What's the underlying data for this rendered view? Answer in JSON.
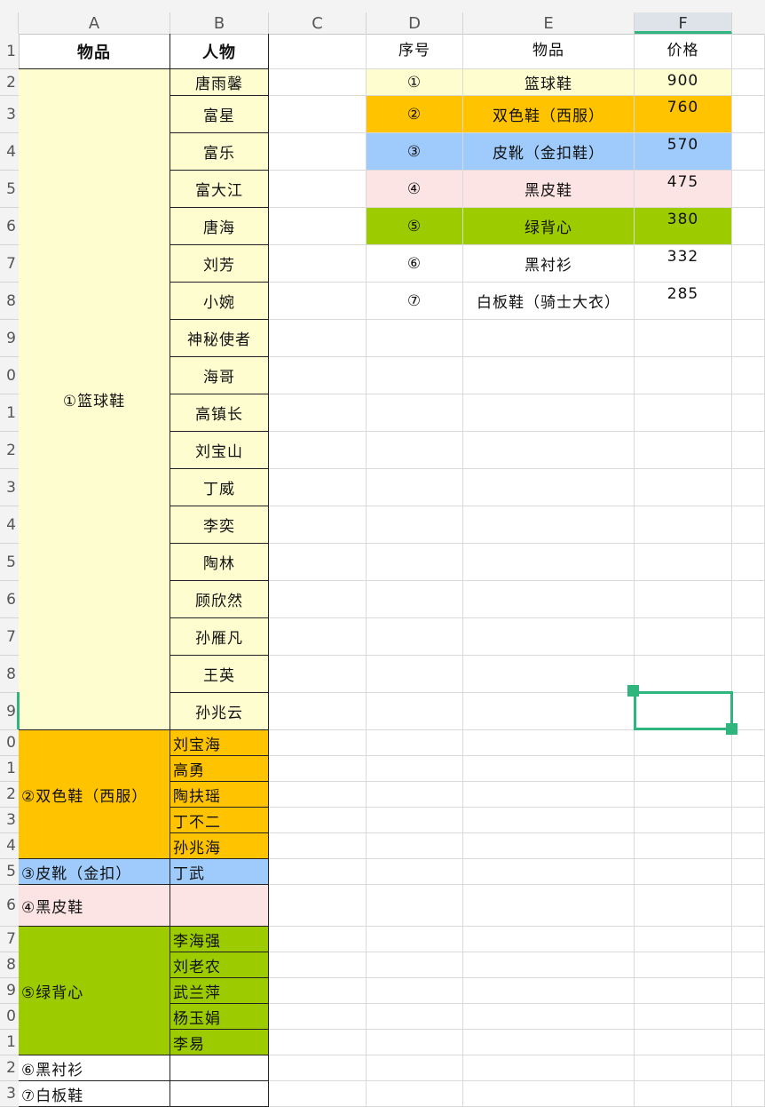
{
  "columns": [
    "A",
    "B",
    "C",
    "D",
    "E",
    "F"
  ],
  "selected_column": "F",
  "row_numbers": [
    "1",
    "2",
    "3",
    "4",
    "5",
    "6",
    "7",
    "8",
    "9",
    "0",
    "1",
    "2",
    "3",
    "4",
    "5",
    "6",
    "7",
    "8",
    "9",
    "0",
    "1",
    "2",
    "3",
    "4",
    "5",
    "6",
    "7",
    "8",
    "9",
    "0",
    "1",
    "2",
    "3"
  ],
  "colors": {
    "basketball": "#fefdd0",
    "two_tone": "#ffc300",
    "leather_buckle": "#9ecbfb",
    "black_leather": "#fde4e4",
    "green_vest": "#9ccb00",
    "selection": "#2fb57e"
  },
  "left_table": {
    "header": {
      "item": "物品",
      "person": "人物"
    },
    "groups": [
      {
        "label": "①篮球鞋",
        "persons": [
          "唐雨馨",
          "富星",
          "富乐",
          "富大江",
          "唐海",
          "刘芳",
          "小婉",
          "神秘使者",
          "海哥",
          "高镇长",
          "刘宝山",
          "丁威",
          "李奕",
          "陶林",
          "顾欣然",
          "孙雁凡",
          "王英",
          "孙兆云"
        ]
      },
      {
        "label": "②双色鞋（西服）",
        "persons": [
          "刘宝海",
          "高勇",
          "陶扶瑶",
          "丁不二",
          "孙兆海"
        ]
      },
      {
        "label": "③皮靴（金扣）",
        "persons": [
          "丁武"
        ]
      },
      {
        "label": "④黑皮鞋",
        "persons": [
          ""
        ]
      },
      {
        "label": "⑤绿背心",
        "persons": [
          "李海强",
          "刘老农",
          "武兰萍",
          "杨玉娟",
          "李易"
        ]
      },
      {
        "label": "⑥黑衬衫",
        "persons": [
          ""
        ]
      },
      {
        "label": "⑦白板鞋",
        "persons": [
          ""
        ]
      }
    ]
  },
  "right_table": {
    "header": {
      "no": "序号",
      "item": "物品",
      "price": "价格"
    },
    "rows": [
      {
        "no": "①",
        "item": "篮球鞋",
        "price": "900"
      },
      {
        "no": "②",
        "item": "双色鞋（西服）",
        "price": "760"
      },
      {
        "no": "③",
        "item": "皮靴（金扣鞋）",
        "price": "570"
      },
      {
        "no": "④",
        "item": "黑皮鞋",
        "price": "475"
      },
      {
        "no": "⑤",
        "item": "绿背心",
        "price": "380"
      },
      {
        "no": "⑥",
        "item": "黑衬衫",
        "price": "332"
      },
      {
        "no": "⑦",
        "item": "白板鞋（骑士大衣）",
        "price": "285"
      }
    ]
  }
}
